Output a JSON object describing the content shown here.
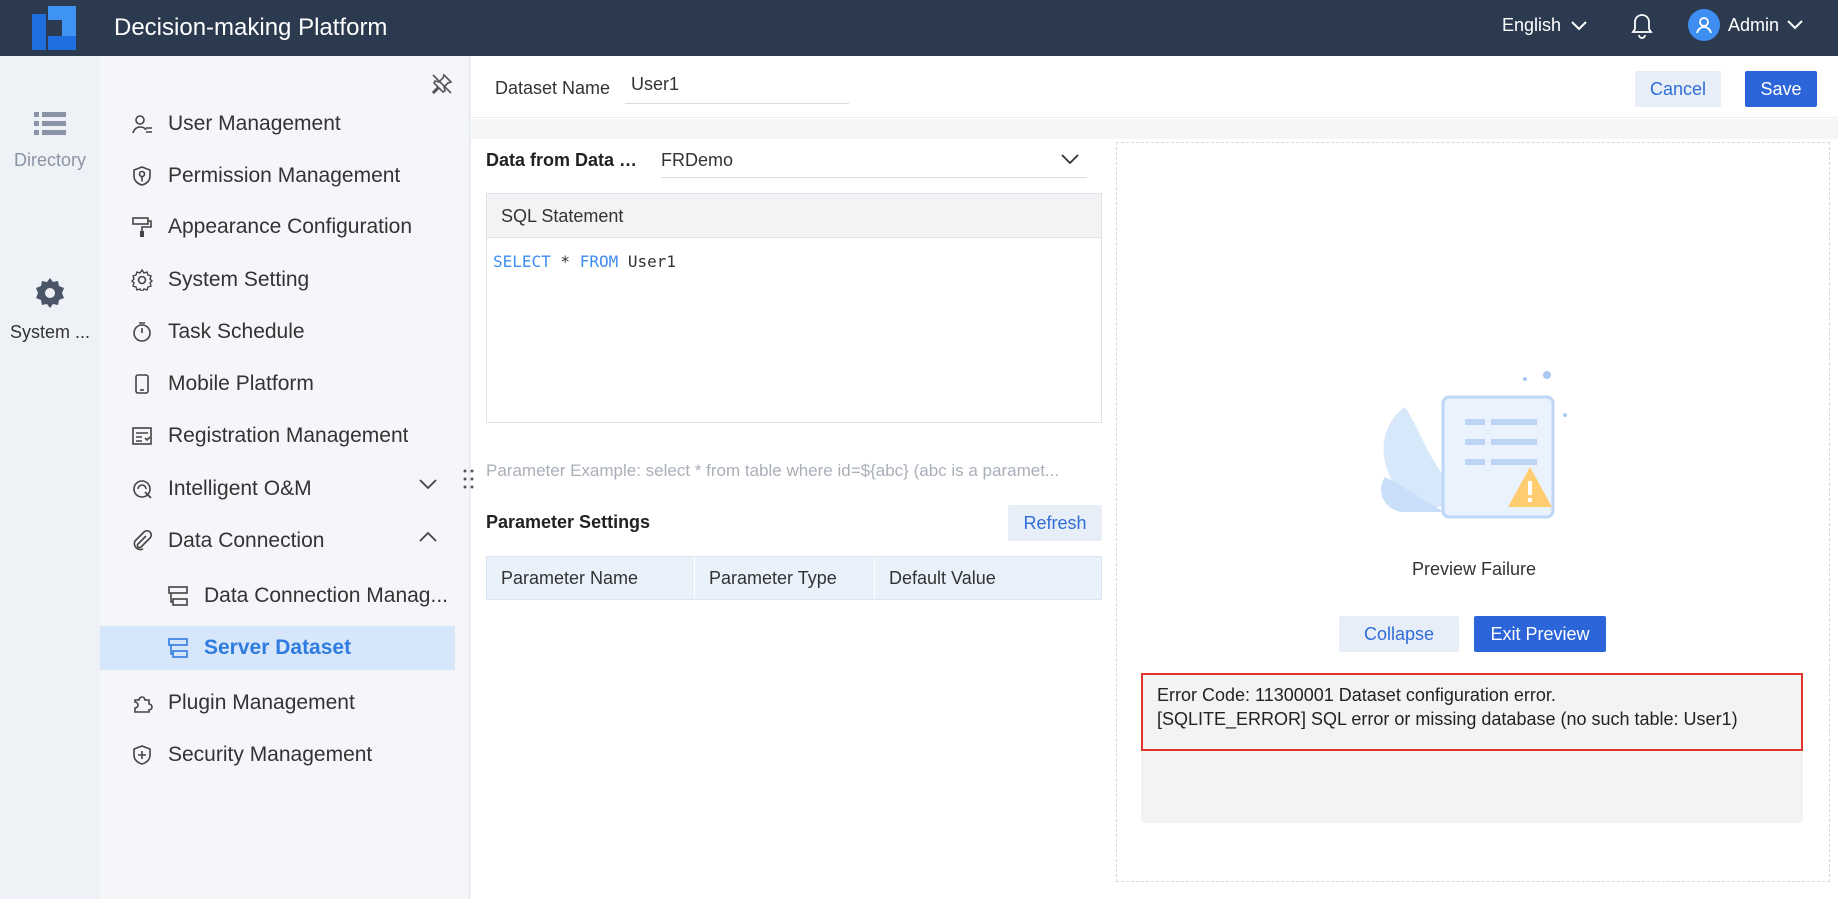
{
  "app": {
    "title": "Decision-making Platform",
    "language": "English",
    "user": "Admin"
  },
  "rail": [
    {
      "label": "Directory",
      "icon": "list-icon"
    },
    {
      "label": "System ...",
      "icon": "gear-icon"
    }
  ],
  "sidebar": {
    "items": [
      {
        "label": "User Management",
        "icon": "user-icon"
      },
      {
        "label": "Permission Management",
        "icon": "shield-key-icon"
      },
      {
        "label": "Appearance Configuration",
        "icon": "paint-roller-icon"
      },
      {
        "label": "System Setting",
        "icon": "gear-icon"
      },
      {
        "label": "Task Schedule",
        "icon": "timer-icon"
      },
      {
        "label": "Mobile Platform",
        "icon": "mobile-icon"
      },
      {
        "label": "Registration Management",
        "icon": "register-icon"
      },
      {
        "label": "Intelligent O&M",
        "icon": "om-icon",
        "expand": "down"
      },
      {
        "label": "Data Connection",
        "icon": "link-icon",
        "expand": "up"
      },
      {
        "label": "Data Connection Manag...",
        "icon": "connection-icon",
        "sub": true
      },
      {
        "label": "Server Dataset",
        "icon": "dataset-icon",
        "sub": true,
        "selected": true
      },
      {
        "label": "Plugin Management",
        "icon": "plugin-icon"
      },
      {
        "label": "Security Management",
        "icon": "security-icon"
      }
    ]
  },
  "editor": {
    "name_label": "Dataset Name",
    "name_value": "User1",
    "cancel": "Cancel",
    "save": "Save",
    "source_label": "Data from Data C...",
    "source_value": "FRDemo",
    "sql_header": "SQL Statement",
    "sql": {
      "kw1": "SELECT",
      "star": " * ",
      "kw2": "FROM",
      "table": " User1"
    },
    "param_hint": "Parameter Example: select * from table where id=${abc} (abc is a paramet...",
    "param_title": "Parameter Settings",
    "refresh": "Refresh",
    "param_columns": [
      "Parameter Name",
      "Parameter Type",
      "Default Value"
    ]
  },
  "preview": {
    "status": "Preview Failure",
    "collapse": "Collapse",
    "exit": "Exit Preview",
    "error_line1": "Error Code: 11300001 Dataset configuration error.",
    "error_line2": "[SQLITE_ERROR] SQL error or missing database (no such table: User1)"
  },
  "colors": {
    "topbar": "#2c3a4f",
    "primary": "#2b65d9",
    "selected_bg": "#d6e7fb",
    "error_border": "#e2312b"
  }
}
